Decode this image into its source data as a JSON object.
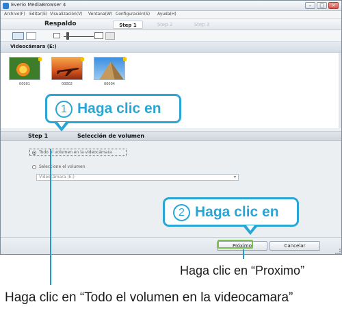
{
  "window": {
    "title": "Everio MediaBrowser 4",
    "controls": {
      "minimize": "–",
      "maximize": "□",
      "close": "×"
    }
  },
  "menu": [
    "Archivo(F)",
    "Editar(E)",
    "Visualización(V)",
    "Ventana(W)",
    "Configuración(S)",
    "Ayuda(H)"
  ],
  "tabbar": {
    "mode": "Respaldo",
    "steps": [
      "Step 1",
      "Step 2",
      "Step 3"
    ]
  },
  "device": {
    "label": "Videocámara (E:)"
  },
  "thumbnails": [
    {
      "name": "00001",
      "icon": "flower-thumbnail"
    },
    {
      "name": "00002",
      "icon": "airplane-thumbnail"
    },
    {
      "name": "00004",
      "icon": "pyramid-thumbnail"
    }
  ],
  "step_panel": {
    "step": "Step 1",
    "title": "Selección de volumen",
    "option_all": "Todo el volumen en la videocámara",
    "option_select": "Seleccione el volumen",
    "volume_select_value": "Videocámara (E:)"
  },
  "buttons": {
    "next": "Próximo",
    "cancel": "Cancelar"
  },
  "callouts": {
    "one": {
      "num": "1",
      "text": "Haga clic en"
    },
    "two": {
      "num": "2",
      "text": "Haga clic en"
    }
  },
  "captions": {
    "next": "Haga clic en “Proximo”",
    "all_volume": "Haga clic en “Todo el volumen en la videocamara”"
  },
  "colors": {
    "accent": "#2aa6d6",
    "focus_green": "#7fc04d"
  }
}
